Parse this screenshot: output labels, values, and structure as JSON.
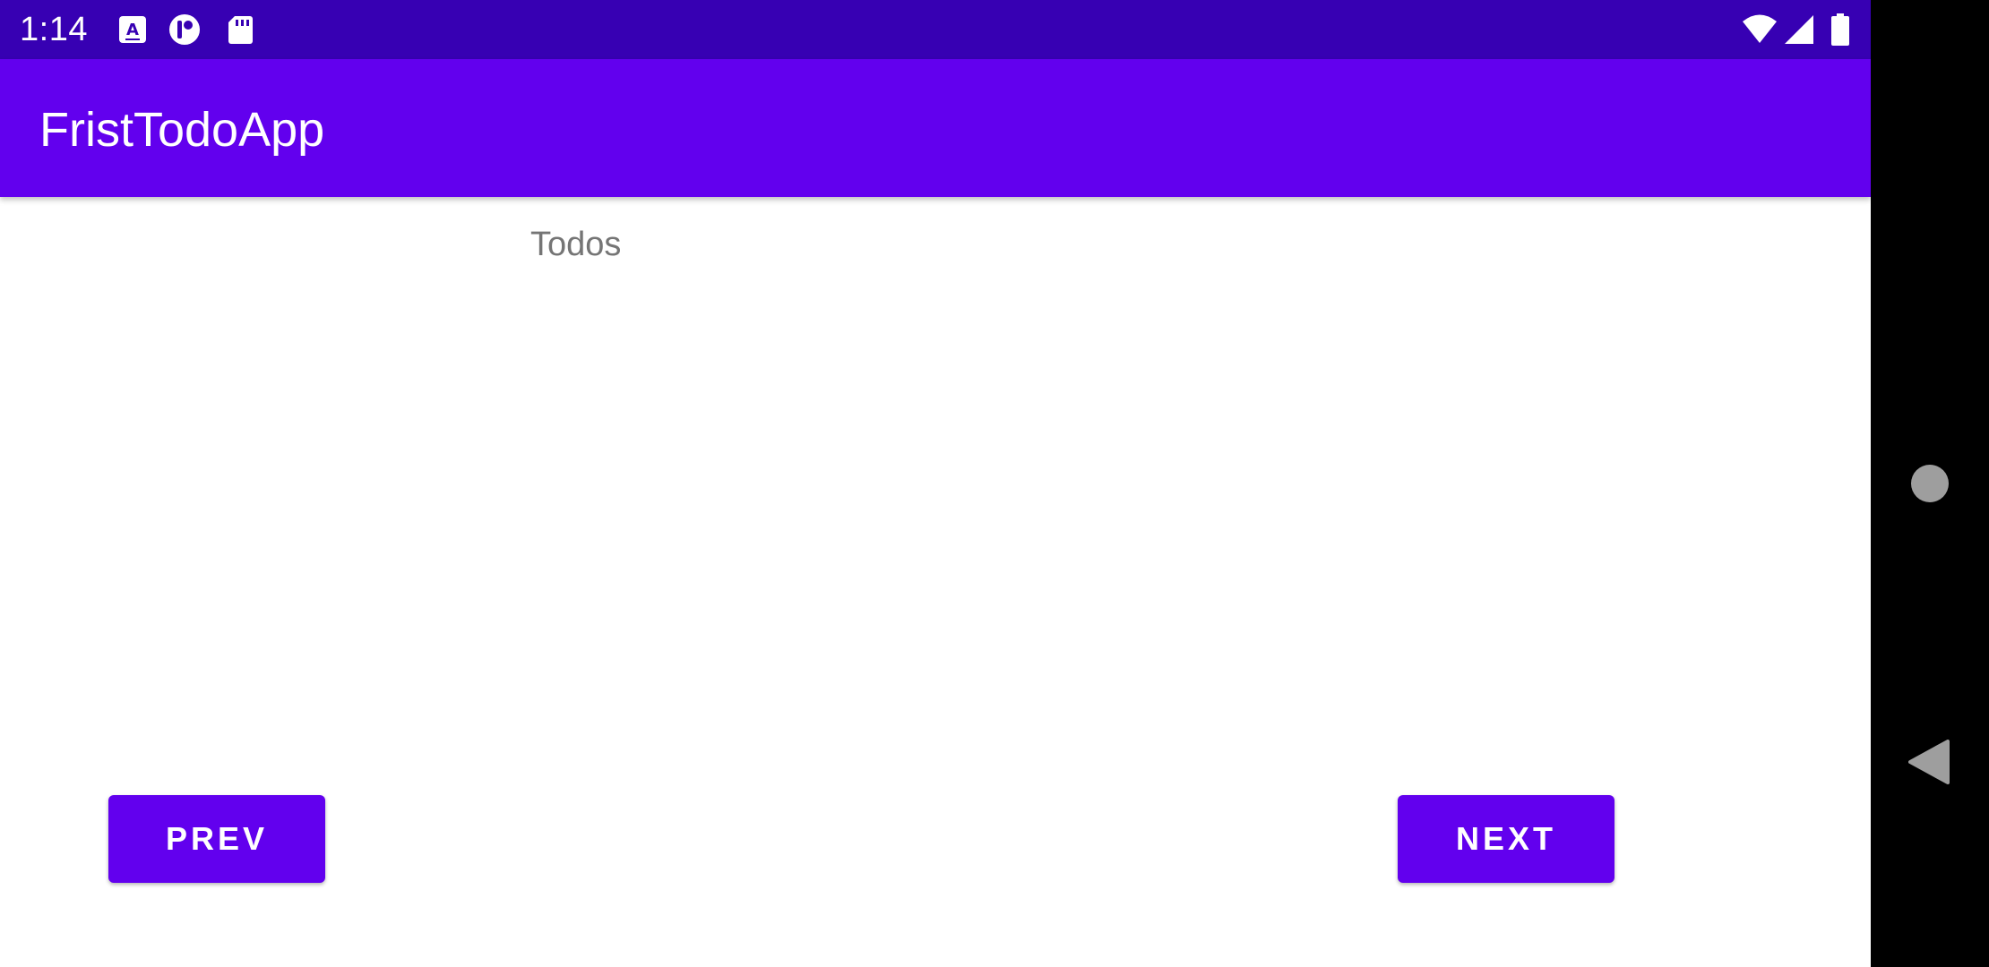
{
  "status_bar": {
    "time": "1:14",
    "icons": [
      "translate-icon",
      "app-badge-icon",
      "sd-card-icon",
      "wifi-icon",
      "cell-signal-icon",
      "battery-icon"
    ]
  },
  "app_bar": {
    "title": "FristTodoApp"
  },
  "main": {
    "section_label": "Todos",
    "prev_label": "PREV",
    "next_label": "NEXT"
  },
  "navigation": {
    "icons": [
      "home-icon",
      "back-icon"
    ]
  },
  "colors": {
    "status_bar": "#3700b3",
    "primary": "#6200ee",
    "secondary_text": "#757575",
    "background": "#ffffff"
  }
}
